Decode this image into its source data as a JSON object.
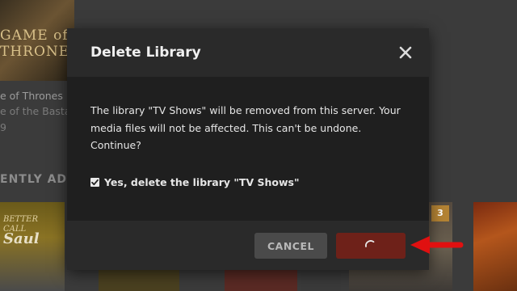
{
  "background": {
    "poster_title": "GAME of THRONES",
    "show_title": "e of Thrones",
    "episode_title": "e of the Basta",
    "episode_number": "9",
    "section_title": "ENTLY ADDE",
    "bcs_poster_line1": "BETTER",
    "bcs_poster_line2": "CALL",
    "bcs_poster_line3": "Saul",
    "badge_count": "3"
  },
  "dialog": {
    "title": "Delete Library",
    "message": "The library \"TV Shows\" will be removed from this server. Your media files will not be affected. This can't be undone. Continue?",
    "confirm_checkbox": {
      "label": "Yes, delete the library \"TV Shows\"",
      "checked": true
    },
    "cancel_label": "CANCEL",
    "delete_state": "loading"
  },
  "colors": {
    "dialog_body": "#1f1f1f",
    "dialog_header": "#2a2a2a",
    "delete_button": "#6e2119",
    "cancel_button": "#4a4a4a",
    "arrow": "#e01010",
    "badge": "#b48334"
  },
  "icons": {
    "close": "close-icon",
    "checkbox": "checkmark-icon",
    "spinner": "spinner-icon",
    "annotation": "red-arrow-icon"
  }
}
